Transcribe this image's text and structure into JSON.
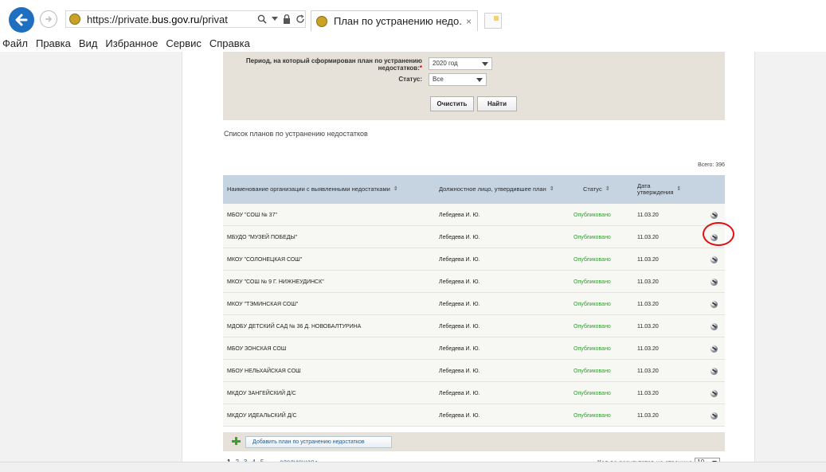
{
  "browser": {
    "url_prefix": "https://private.",
    "url_domain": "bus.gov.ru",
    "url_suffix": "/privat",
    "tab_title": "План по устранению недо...",
    "tab_close": "×"
  },
  "menu": [
    "Файл",
    "Правка",
    "Вид",
    "Избранное",
    "Сервис",
    "Справка"
  ],
  "filter": {
    "period_label_line1": "Период, на который сформирован план по устранению",
    "period_label_line2": "недостатков:",
    "required_mark": "*",
    "period_value": "2020 год",
    "status_label": "Статус:",
    "status_value": "Все",
    "clear_button": "Очистить",
    "find_button": "Найти"
  },
  "list": {
    "title": "Список планов по устранению недостатков",
    "total": "Всего: 396",
    "columns": {
      "org": "Наименование организации с выявленными недостатками",
      "official": "Должностное лицо, утвердившее план",
      "status": "Статус",
      "date_line1": "Дата",
      "date_line2": "утверждения",
      "sort_glyph": "⇕"
    },
    "rows": [
      {
        "org": "МБОУ \"СОШ № 37\"",
        "official": "Лебедева И. Ю.",
        "status": "Опубликовано",
        "date": "11.03.20"
      },
      {
        "org": "МБУДО \"МУЗЕЙ ПОБЕДЫ\"",
        "official": "Лебедева И. Ю.",
        "status": "Опубликовано",
        "date": "11.03.20"
      },
      {
        "org": "МКОУ \"СОЛОНЕЦКАЯ СОШ\"",
        "official": "Лебедева И. Ю.",
        "status": "Опубликовано",
        "date": "11.03.20"
      },
      {
        "org": "МКОУ \"СОШ № 9 Г. НИЖНЕУДИНСК\"",
        "official": "Лебедева И. Ю.",
        "status": "Опубликовано",
        "date": "11.03.20"
      },
      {
        "org": "МКОУ \"ТЭМИНСКАЯ СОШ\"",
        "official": "Лебедева И. Ю.",
        "status": "Опубликовано",
        "date": "11.03.20"
      },
      {
        "org": "МДОБУ ДЕТСКИЙ САД № 36 Д. НОВОБАЛТУРИНА",
        "official": "Лебедева И. Ю.",
        "status": "Опубликовано",
        "date": "11.03.20"
      },
      {
        "org": "МБОУ ЗОНСКАЯ СОШ",
        "official": "Лебедева И. Ю.",
        "status": "Опубликовано",
        "date": "11.03.20"
      },
      {
        "org": "МБОУ НЕЛЬХАЙСКАЯ СОШ",
        "official": "Лебедева И. Ю.",
        "status": "Опубликовано",
        "date": "11.03.20"
      },
      {
        "org": "МКДОУ ЗАНГЕЙСКИЙ Д/С",
        "official": "Лебедева И. Ю.",
        "status": "Опубликовано",
        "date": "11.03.20"
      },
      {
        "org": "МКДОУ ИДЕАЛЬСКИЙ Д/С",
        "official": "Лебедева И. Ю.",
        "status": "Опубликовано",
        "date": "11.03.20"
      }
    ],
    "add_button": "Добавить план по устранению недостатков"
  },
  "pager": {
    "pages": [
      "1",
      "2",
      "3",
      "4",
      "5"
    ],
    "next": "следующая",
    "per_page_label": "Кол-во результатов на странице",
    "per_page_value": "10"
  },
  "colors": {
    "accent_blue": "#1e6fbf",
    "status_green": "#2f9e2f",
    "highlight_red": "#e01010",
    "header_bg": "#c6d4e2"
  }
}
